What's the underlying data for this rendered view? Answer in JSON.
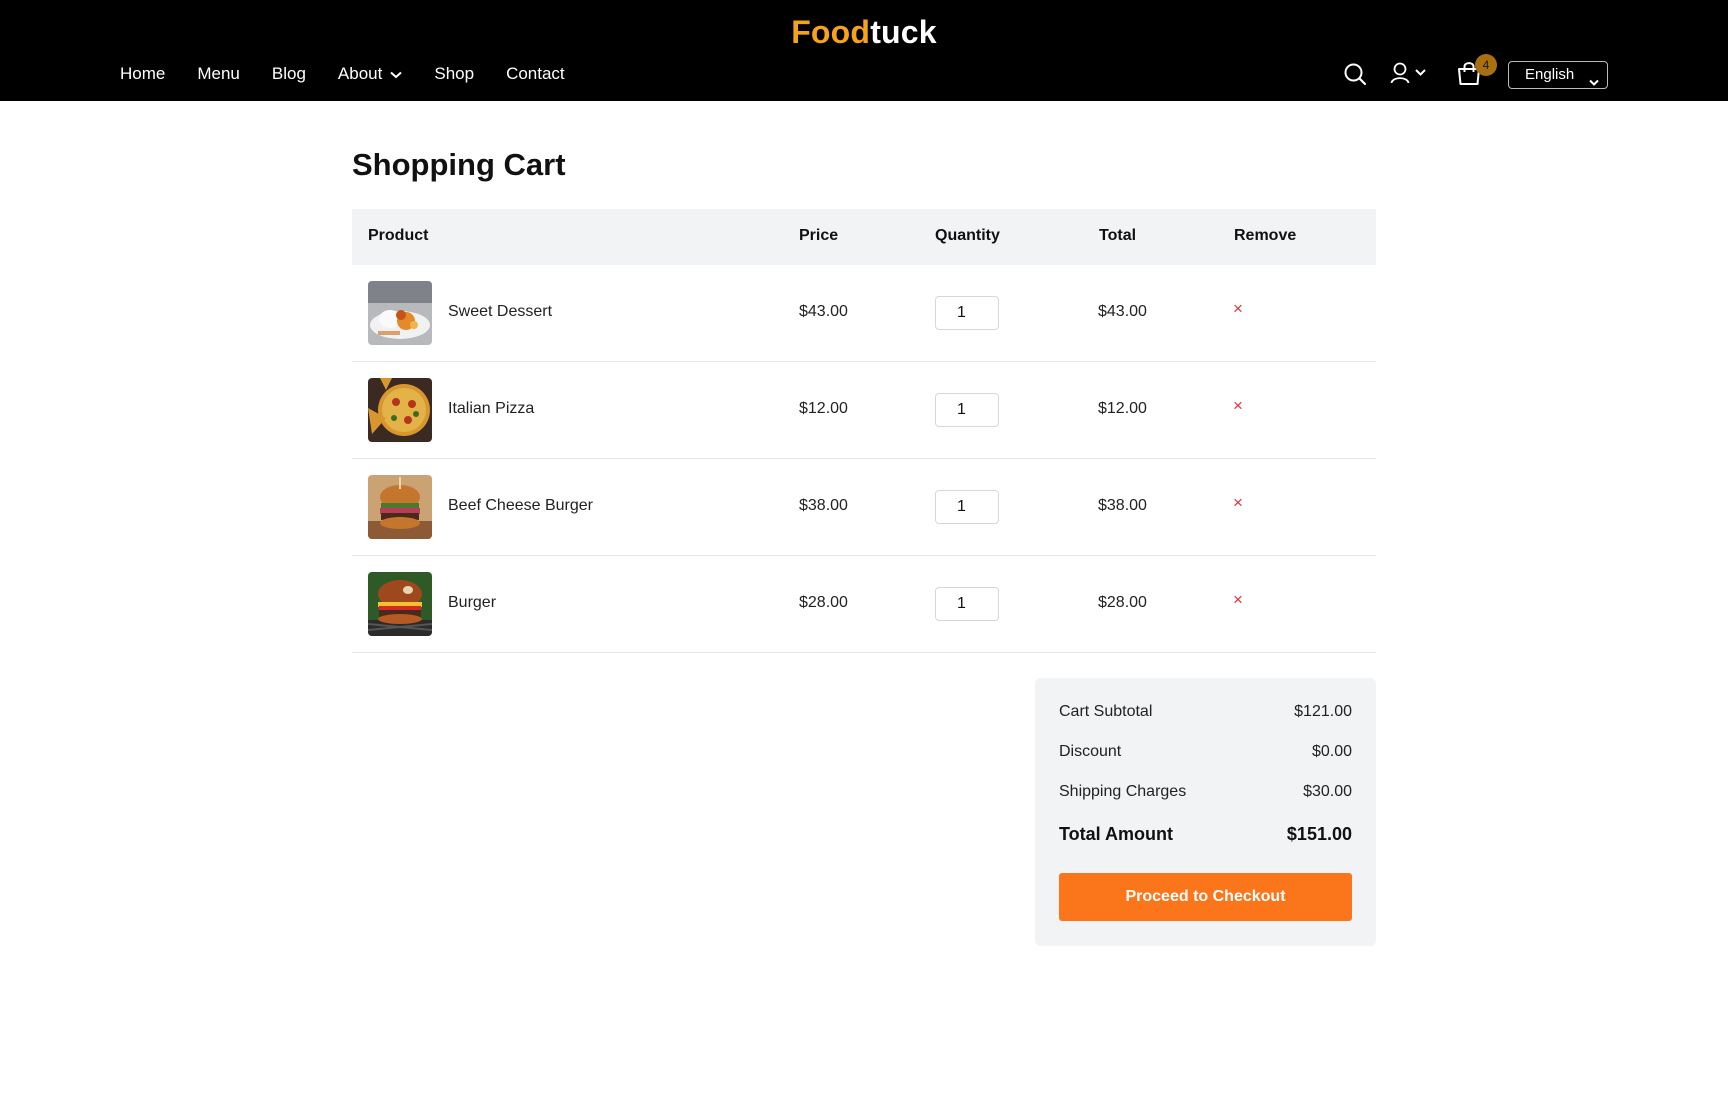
{
  "brand": {
    "part1": "Food",
    "part2": "tuck",
    "accent": "#f7a21b"
  },
  "nav": {
    "items": [
      "Home",
      "Menu",
      "Blog",
      "About",
      "Shop",
      "Contact"
    ]
  },
  "header_tools": {
    "search_icon": "search-icon",
    "user_icon": "user-icon",
    "cart_icon": "shopping-bag-icon",
    "cart_count": "4",
    "language": "English"
  },
  "page": {
    "title": "Shopping Cart"
  },
  "table": {
    "headers": [
      "Product",
      "Price",
      "Quantity",
      "Total",
      "Remove"
    ],
    "rows": [
      {
        "name": "Sweet Dessert",
        "price": "$43.00",
        "qty": "1",
        "total": "$43.00",
        "remove": "×"
      },
      {
        "name": "Italian Pizza",
        "price": "$12.00",
        "qty": "1",
        "total": "$12.00",
        "remove": "×"
      },
      {
        "name": "Beef Cheese Burger",
        "price": "$38.00",
        "qty": "1",
        "total": "$38.00",
        "remove": "×"
      },
      {
        "name": "Burger",
        "price": "$28.00",
        "qty": "1",
        "total": "$28.00",
        "remove": "×"
      }
    ]
  },
  "summary": {
    "subtotal_label": "Cart Subtotal",
    "subtotal": "$121.00",
    "discount_label": "Discount",
    "discount": "$0.00",
    "shipping_label": "Shipping Charges",
    "shipping": "$30.00",
    "total_label": "Total Amount",
    "total": "$151.00",
    "checkout_label": "Proceed to Checkout",
    "checkout_color": "#fb751b"
  }
}
